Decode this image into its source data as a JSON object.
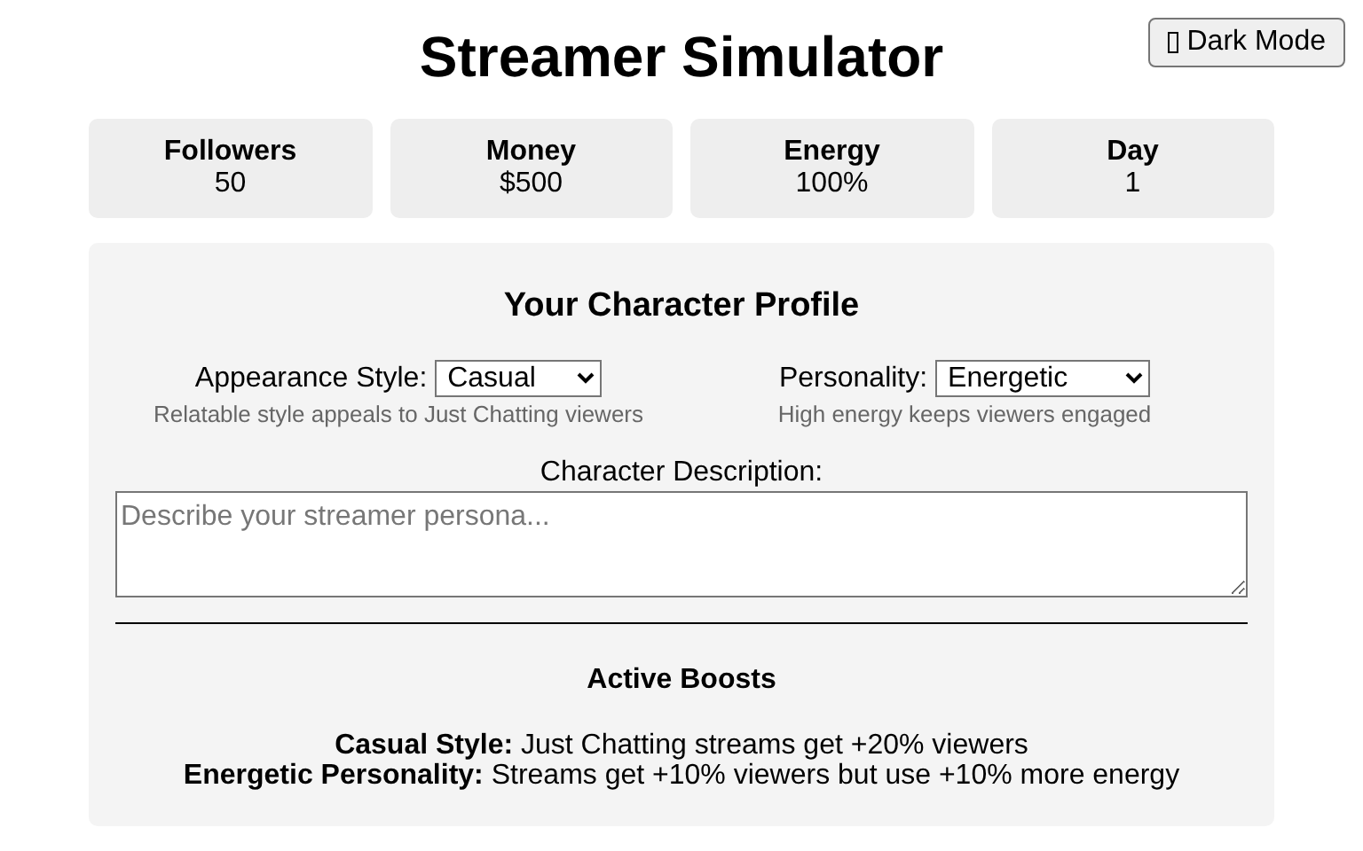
{
  "theme_button": {
    "label": "Dark Mode"
  },
  "title": "Streamer Simulator",
  "stats": [
    {
      "label": "Followers",
      "value": "50"
    },
    {
      "label": "Money",
      "value": "$500"
    },
    {
      "label": "Energy",
      "value": "100%"
    },
    {
      "label": "Day",
      "value": "1"
    }
  ],
  "profile": {
    "heading": "Your Character Profile",
    "selects": [
      {
        "label": "Appearance Style:",
        "value": "Casual",
        "hint": "Relatable style appeals to Just Chatting viewers"
      },
      {
        "label": "Personality:",
        "value": "Energetic",
        "hint": "High energy keeps viewers engaged"
      }
    ],
    "description": {
      "label": "Character Description:",
      "placeholder": "Describe your streamer persona..."
    },
    "boosts_heading": "Active Boosts",
    "boosts": [
      "**Casual Style:** Just Chatting streams get +20% viewers",
      "**Energetic Personality:** Streams get +10% viewers but use +10% more energy"
    ]
  }
}
